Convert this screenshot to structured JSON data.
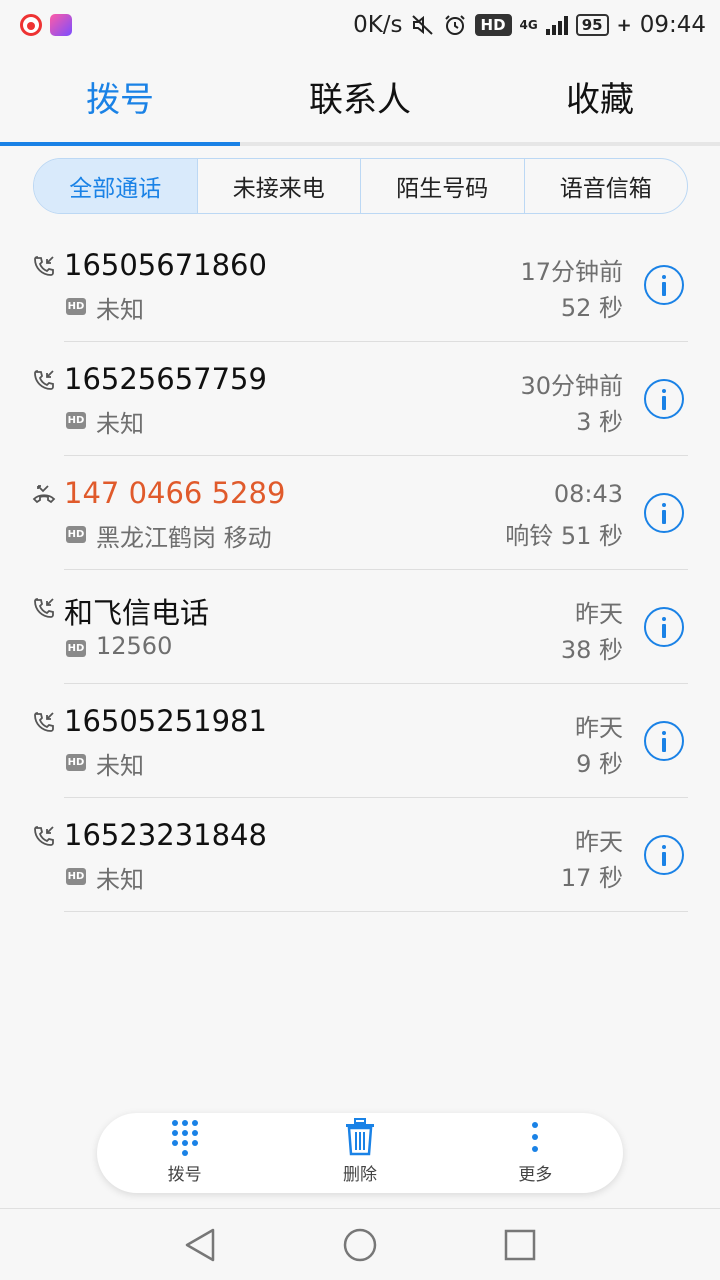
{
  "status_bar": {
    "speed": "0K/s",
    "hd": "HD",
    "network": "4G",
    "battery": "95",
    "time": "09:44"
  },
  "top_tabs": [
    {
      "label": "拨号",
      "active": true
    },
    {
      "label": "联系人",
      "active": false
    },
    {
      "label": "收藏",
      "active": false
    }
  ],
  "filters": [
    {
      "label": "全部通话",
      "active": true
    },
    {
      "label": "未接来电",
      "active": false
    },
    {
      "label": "陌生号码",
      "active": false
    },
    {
      "label": "语音信箱",
      "active": false
    }
  ],
  "calls": [
    {
      "name": "16505671860",
      "sub": "未知",
      "time": "17分钟前",
      "duration": "52 秒",
      "type": "incoming",
      "hd": "HD"
    },
    {
      "name": "16525657759",
      "sub": "未知",
      "time": "30分钟前",
      "duration": "3 秒",
      "type": "incoming",
      "hd": "HD"
    },
    {
      "name": "147 0466 5289",
      "sub": "黑龙江鹤岗 移动",
      "time": "08:43",
      "duration": "响铃 51 秒",
      "type": "missed",
      "hd": "HD"
    },
    {
      "name": "和飞信电话",
      "sub": "12560",
      "time": "昨天",
      "duration": "38 秒",
      "type": "incoming",
      "hd": "HD"
    },
    {
      "name": "16505251981",
      "sub": "未知",
      "time": "昨天",
      "duration": "9 秒",
      "type": "incoming",
      "hd": "HD"
    },
    {
      "name": "16523231848",
      "sub": "未知",
      "time": "昨天",
      "duration": "17 秒",
      "type": "incoming",
      "hd": "HD"
    }
  ],
  "actions": {
    "dial": "拨号",
    "delete": "删除",
    "more": "更多"
  },
  "colors": {
    "accent": "#1a82e6",
    "missed": "#e05a2b"
  }
}
